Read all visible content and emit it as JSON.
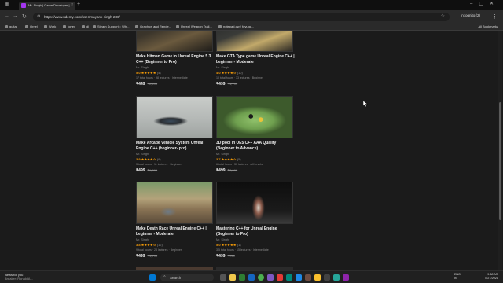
{
  "browser": {
    "tab_title": "Mr. Singh | Game Developer | ...",
    "tab_close": "×",
    "new_tab": "+",
    "url": "https://www.udemy.com/user/mayank-singh-236/",
    "profile_label": "Incognito (2)",
    "bookmarks": [
      "guitar",
      "Ornel",
      "Work",
      "fortex",
      "dl",
      "Steam Support :: Wh...",
      "Graphics and Rende...",
      "Unreal Weapon Trail...",
      "notepad.pw / foyuga..."
    ],
    "all_bookmarks": "All Bookmarks"
  },
  "courses": [
    {
      "title": "Make Hitman Game in Unreal Engine 5.3 C++ (Beginner to Pro)",
      "author": "Mr. Singh",
      "rating": "5.0",
      "stars": "★★★★★",
      "count": "(4)",
      "meta": "17 total hours · 98 lectures · Intermediate",
      "price": "₹449",
      "old_price": "₹2,499"
    },
    {
      "title": "Make GTA Type game Unreal Engine C++ | beginner - Moderate",
      "author": "Mr. Singh",
      "rating": "4.0",
      "stars": "★★★★☆",
      "count": "(10)",
      "meta": "10 total hours · 33 lectures · Beginner",
      "price": "₹499",
      "old_price": "₹1,799"
    },
    {
      "title": "Make Arcade Vehicle System Unreal Engine C++ (beginner- pro)",
      "author": "Mr. Singh",
      "rating": "3.9",
      "stars": "★★★★☆",
      "count": "(9)",
      "meta": "3 total hours · 11 lectures · Beginner",
      "price": "₹499",
      "old_price": "₹1,899"
    },
    {
      "title": "3D pool in UE5 C++ AAA Quality (Beginner to Advance)",
      "author": "Mr. Singh",
      "rating": "3.7",
      "stars": "★★★★☆",
      "count": "(5)",
      "meta": "6 total hours · 30 lectures · All Levels",
      "price": "₹499",
      "old_price": "₹2,099"
    },
    {
      "title": "Make Death Race Unreal Engine C++ | beginner - Moderate",
      "author": "Mr. Singh",
      "rating": "3.8",
      "stars": "★★★★☆",
      "count": "(12)",
      "meta": "9 total hours · 23 lectures · Beginner",
      "price": "₹499",
      "old_price": "₹1,799"
    },
    {
      "title": "Mastering C++ for Unreal Engine (Beginner to Pro)",
      "author": "Mr. Singh",
      "rating": "5.0",
      "stars": "★★★★★",
      "count": "(1)",
      "meta": "3.5 total hours · 15 lectures · Intermediate",
      "price": "₹499",
      "old_price": "₹799"
    }
  ],
  "taskbar": {
    "news_title": "News for you",
    "news_sub": "Breaker: Ronald A...",
    "search": "Search",
    "lang1": "ENG",
    "lang2": "IN",
    "time": "9:38 AM",
    "date": "5/27/2024"
  }
}
